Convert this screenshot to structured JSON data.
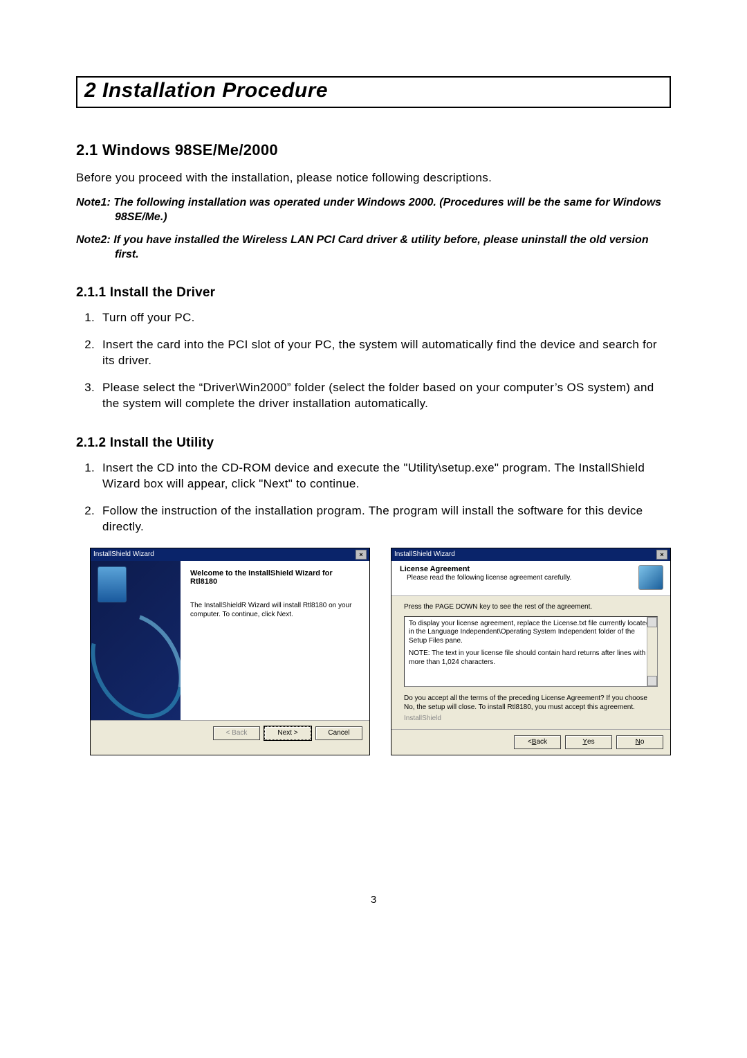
{
  "chapter": {
    "title": "2 Installation Procedure"
  },
  "section21": {
    "heading": "2.1    Windows 98SE/Me/2000",
    "intro": "Before you proceed with the installation, please notice following descriptions.",
    "note1": "Note1: The following installation was operated under Windows 2000.  (Procedures will be the same for Windows 98SE/Me.)",
    "note2": "Note2: If you have installed the Wireless LAN PCI Card driver & utility before, please uninstall the old version first."
  },
  "section211": {
    "heading": "2.1.1  Install the Driver",
    "items": [
      "Turn off your PC.",
      "Insert the card into the PCI slot of your PC, the system will automatically find the device and search for its driver.",
      "Please select the “Driver\\Win2000” folder (select the folder based on your computer’s OS system) and the system will complete the driver installation automatically."
    ]
  },
  "section212": {
    "heading": "2.1.2  Install the Utility",
    "items": [
      "Insert the CD into the CD-ROM device and execute the \"Utility\\setup.exe\" program. The InstallShield Wizard box will appear, click \"Next\" to continue.",
      "Follow the instruction of the installation program. The program will install the software for this device directly."
    ]
  },
  "wizard1": {
    "title": "InstallShield Wizard",
    "heading": "Welcome to the InstallShield Wizard for Rtl8180",
    "body": "The InstallShieldR Wizard will install Rtl8180 on your computer. To continue, click Next.",
    "back": "< Back",
    "next": "Next >",
    "cancel": "Cancel"
  },
  "wizard2": {
    "title": "InstallShield Wizard",
    "headerTitle": "License Agreement",
    "headerSub": "Please read the following license agreement carefully.",
    "instruction": "Press the PAGE DOWN key to see the rest of the agreement.",
    "licenseLine1": "To display your license agreement, replace the License.txt file currently located in the Language Independent\\Operating System Independent folder of the Setup Files pane.",
    "licenseLine2": "NOTE: The text in your license file should contain hard returns after lines with more than 1,024 characters.",
    "accept": "Do you accept all the terms of the preceding License Agreement? If you choose No, the setup will close. To install Rtl8180, you must accept this agreement.",
    "installshield": "InstallShield",
    "back": "< Back",
    "yes": "Yes",
    "no": "No"
  },
  "pageNumber": "3"
}
